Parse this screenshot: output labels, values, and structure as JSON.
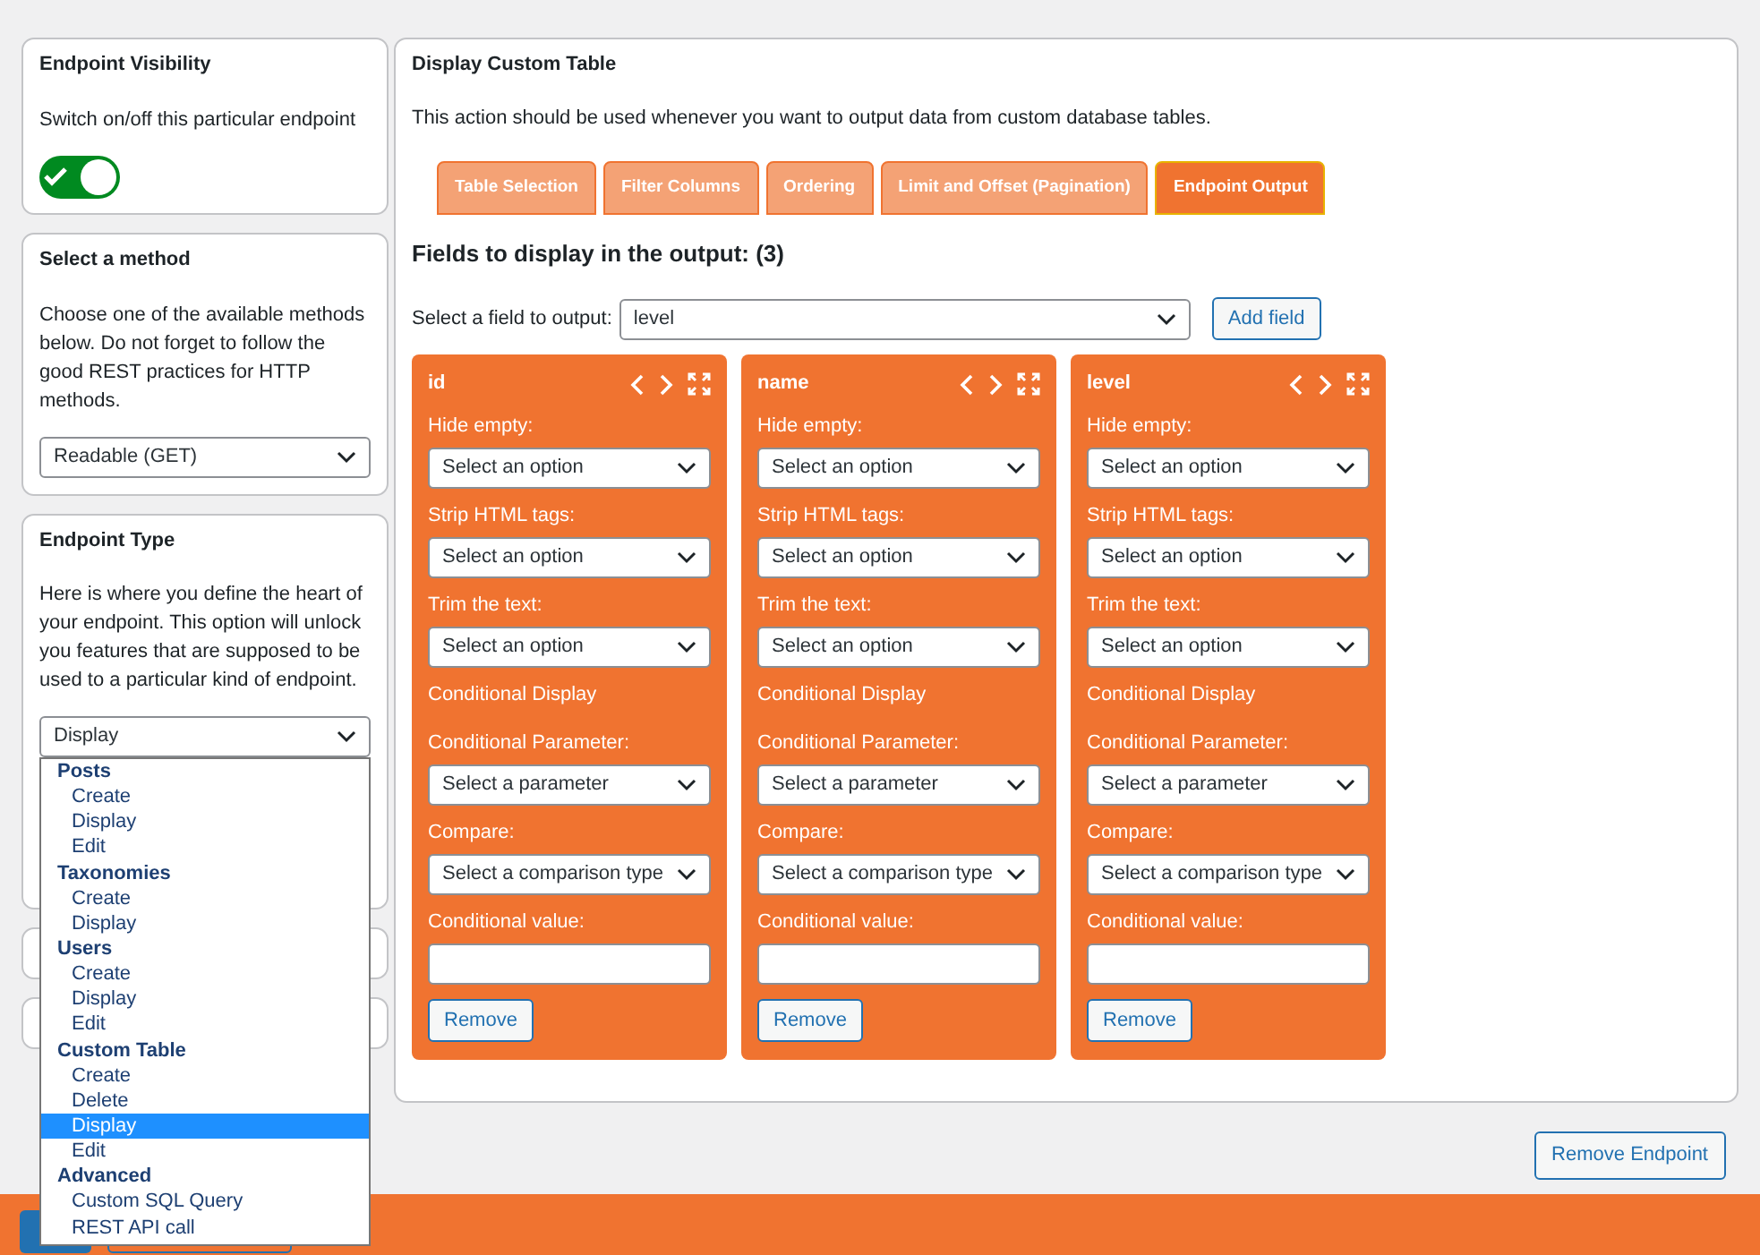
{
  "sidebar": {
    "visibility": {
      "title": "Endpoint Visibility",
      "text": "Switch on/off this particular endpoint",
      "on": true
    },
    "method": {
      "title": "Select a method",
      "text": "Choose one of the available methods below. Do not forget to follow the good REST practices for HTTP methods.",
      "value": "Readable (GET)"
    },
    "endpoint_type": {
      "title": "Endpoint Type",
      "text": "Here is where you define the heart of your endpoint. This option will unlock you features that are supposed to be used to a particular kind of endpoint.",
      "value": "Display",
      "dropdown": [
        {
          "label": "Posts",
          "options": [
            {
              "label": "Create",
              "selected": false
            },
            {
              "label": "Display",
              "selected": false
            },
            {
              "label": "Edit",
              "selected": false
            }
          ]
        },
        {
          "label": "Taxonomies",
          "options": [
            {
              "label": "Create",
              "selected": false
            },
            {
              "label": "Display",
              "selected": false
            }
          ]
        },
        {
          "label": "Users",
          "options": [
            {
              "label": "Create",
              "selected": false
            },
            {
              "label": "Display",
              "selected": false
            },
            {
              "label": "Edit",
              "selected": false
            }
          ]
        },
        {
          "label": "Custom Table",
          "options": [
            {
              "label": "Create",
              "selected": false
            },
            {
              "label": "Delete",
              "selected": false
            },
            {
              "label": "Display",
              "selected": true
            },
            {
              "label": "Edit",
              "selected": false
            }
          ]
        },
        {
          "label": "Advanced",
          "options": [
            {
              "label": "Custom SQL Query",
              "selected": false
            },
            {
              "label": "REST API call",
              "selected": false
            }
          ]
        }
      ]
    }
  },
  "main": {
    "title": "Display Custom Table",
    "description": "This action should be used whenever you want to output data from custom database tables.",
    "tabs": [
      {
        "label": "Table Selection",
        "selected": false
      },
      {
        "label": "Filter Columns",
        "selected": false
      },
      {
        "label": "Ordering",
        "selected": false
      },
      {
        "label": "Limit and Offset (Pagination)",
        "selected": false
      },
      {
        "label": "Endpoint Output",
        "selected": true
      }
    ],
    "heading": "Fields to display in the output: (3)",
    "field_picker": {
      "label": "Select a field to output:",
      "value": "level",
      "button": "Add field"
    },
    "fields": [
      {
        "name": "id",
        "rows": [
          {
            "kind": "select",
            "label": "Hide empty:",
            "value": "Select an option"
          },
          {
            "kind": "select",
            "label": "Strip HTML tags:",
            "value": "Select an option"
          },
          {
            "kind": "select",
            "label": "Trim the text:",
            "value": "Select an option"
          },
          {
            "kind": "heading",
            "label": "Conditional Display"
          },
          {
            "kind": "select",
            "label": "Conditional Parameter:",
            "value": "Select a parameter"
          },
          {
            "kind": "select",
            "label": "Compare:",
            "value": "Select a comparison type"
          },
          {
            "kind": "input",
            "label": "Conditional value:"
          }
        ],
        "button": "Remove"
      },
      {
        "name": "name",
        "rows": [
          {
            "kind": "select",
            "label": "Hide empty:",
            "value": "Select an option"
          },
          {
            "kind": "select",
            "label": "Strip HTML tags:",
            "value": "Select an option"
          },
          {
            "kind": "select",
            "label": "Trim the text:",
            "value": "Select an option"
          },
          {
            "kind": "heading",
            "label": "Conditional Display"
          },
          {
            "kind": "select",
            "label": "Conditional Parameter:",
            "value": "Select a parameter"
          },
          {
            "kind": "select",
            "label": "Compare:",
            "value": "Select a comparison type"
          },
          {
            "kind": "input",
            "label": "Conditional value:"
          }
        ],
        "button": "Remove"
      },
      {
        "name": "level",
        "rows": [
          {
            "kind": "select",
            "label": "Hide empty:",
            "value": "Select an option"
          },
          {
            "kind": "select",
            "label": "Strip HTML tags:",
            "value": "Select an option"
          },
          {
            "kind": "select",
            "label": "Trim the text:",
            "value": "Select an option"
          },
          {
            "kind": "heading",
            "label": "Conditional Display"
          },
          {
            "kind": "select",
            "label": "Conditional Parameter:",
            "value": "Select a parameter"
          },
          {
            "kind": "select",
            "label": "Compare:",
            "value": "Select a comparison type"
          },
          {
            "kind": "input",
            "label": "Conditional value:"
          }
        ],
        "button": "Remove"
      }
    ]
  },
  "remove_endpoint": "Remove Endpoint"
}
